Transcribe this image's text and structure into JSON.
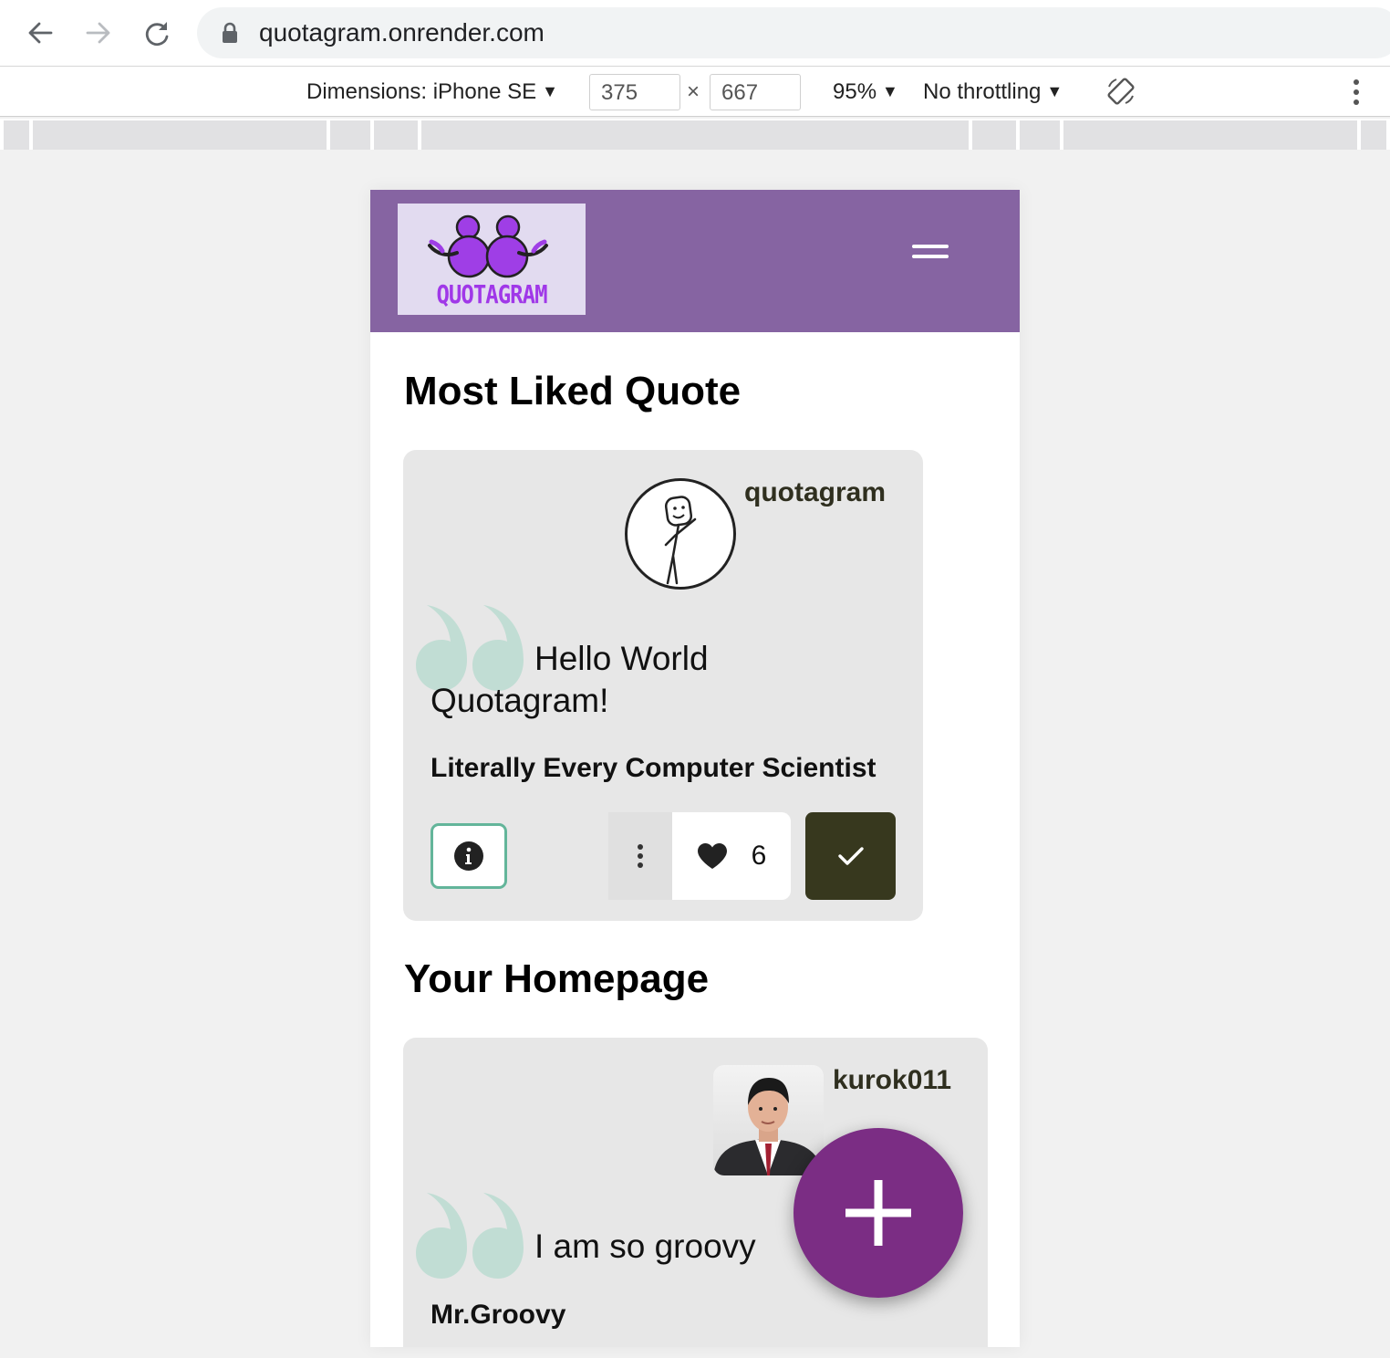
{
  "browser": {
    "url": "quotagram.onrender.com",
    "devtools": {
      "dimensions_label": "Dimensions: iPhone SE",
      "width": "375",
      "times": "×",
      "height": "667",
      "zoom": "95%",
      "throttling": "No throttling"
    }
  },
  "app": {
    "logo_text": "QUOTAGRAM",
    "brand_color": "#8664a2",
    "accent_color": "#7b2d84",
    "most_liked": {
      "section_title": "Most Liked Quote",
      "username": "quotagram",
      "quote": "Hello World Quotagram!",
      "author": "Literally Every Computer Scientist",
      "likes": "6"
    },
    "homepage": {
      "section_title": "Your Homepage",
      "username": "kurok011",
      "quote": "I am so groovy",
      "author": "Mr.Groovy"
    }
  }
}
